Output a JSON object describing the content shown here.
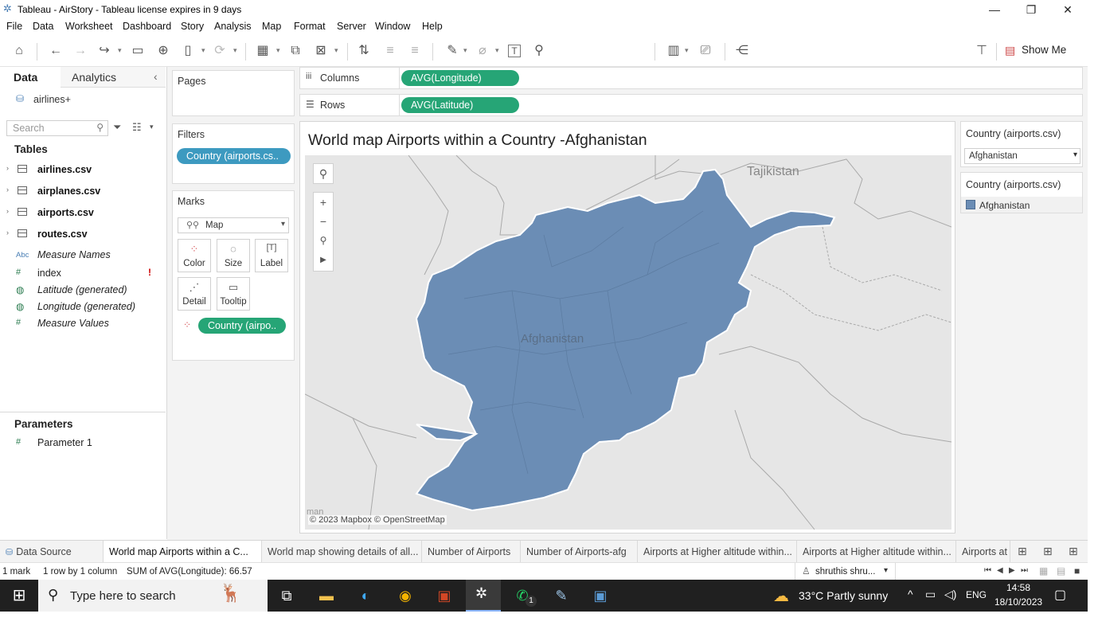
{
  "window": {
    "title": "Tableau - AirStory - Tableau license expires in 9 days"
  },
  "menu": [
    "File",
    "Data",
    "Worksheet",
    "Dashboard",
    "Story",
    "Analysis",
    "Map",
    "Format",
    "Server",
    "Window",
    "Help"
  ],
  "toolbar": {
    "show_me_label": "Show Me"
  },
  "data_pane": {
    "tab_data": "Data",
    "tab_analytics": "Analytics",
    "datasource": "airlines+",
    "search_placeholder": "Search",
    "tables_heading": "Tables",
    "tables": [
      "airlines.csv",
      "airplanes.csv",
      "airports.csv",
      "routes.csv"
    ],
    "fields": [
      {
        "icon": "Abc",
        "name": "Measure Names",
        "italic": true
      },
      {
        "icon": "#",
        "name": "index",
        "italic": false,
        "warning": "!"
      },
      {
        "icon": "globe",
        "name": "Latitude (generated)",
        "italic": true
      },
      {
        "icon": "globe",
        "name": "Longitude (generated)",
        "italic": true
      },
      {
        "icon": "#",
        "name": "Measure Values",
        "italic": true
      }
    ],
    "parameters_heading": "Parameters",
    "parameters": [
      "Parameter 1"
    ]
  },
  "shelves": {
    "pages_title": "Pages",
    "filters_title": "Filters",
    "filter_pill": "Country (airports.cs..",
    "marks_title": "Marks",
    "mark_type": "Map",
    "mark_buttons": [
      "Color",
      "Size",
      "Label",
      "Detail",
      "Tooltip"
    ],
    "marks_pill": "Country (airpo..",
    "columns_label": "Columns",
    "columns_pill": "AVG(Longitude)",
    "rows_label": "Rows",
    "rows_pill": "AVG(Latitude)"
  },
  "view": {
    "title": "World map Airports within a Country -Afghanistan",
    "map_labels": {
      "country": "Afghanistan",
      "neighbor": "Tajikistan",
      "edge": "man"
    },
    "attribution": "© 2023 Mapbox © OpenStreetMap",
    "fill_color": "#6b8db5"
  },
  "filter_card": {
    "title": "Country (airports.csv)",
    "selected": "Afghanistan"
  },
  "legend_card": {
    "title": "Country (airports.csv)",
    "item": "Afghanistan",
    "item_color": "#6b8db5"
  },
  "sheet_tabs": [
    {
      "label": "Data Source",
      "active": false
    },
    {
      "label": "World map Airports within a C...",
      "active": true
    },
    {
      "label": "World map showing details of all...",
      "active": false
    },
    {
      "label": "Number of Airports",
      "active": false
    },
    {
      "label": "Number of Airports-afg",
      "active": false
    },
    {
      "label": "Airports at Higher altitude within...",
      "active": false
    },
    {
      "label": "Airports at Higher altitude within...",
      "active": false
    },
    {
      "label": "Airports at",
      "active": false
    }
  ],
  "status": {
    "marks": "1 mark",
    "rows": "1 row by 1 column",
    "sum": "SUM of AVG(Longitude): 66.57",
    "user": "shruthis shru..."
  },
  "taskbar": {
    "search_placeholder": "Type here to search",
    "weather": "33°C  Partly sunny",
    "language": "ENG",
    "time": "14:58",
    "date": "18/10/2023",
    "whatsapp_badge": "1"
  }
}
